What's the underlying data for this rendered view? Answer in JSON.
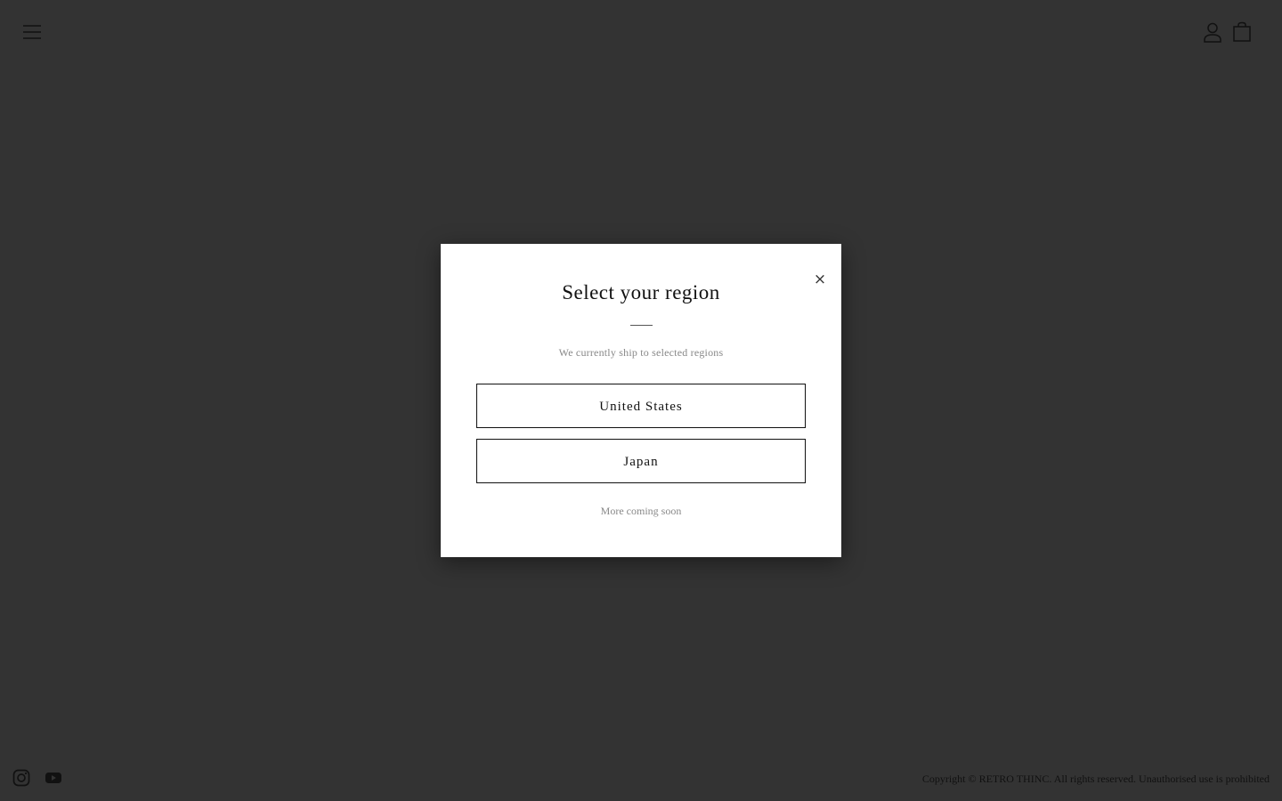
{
  "header": {
    "menu_icon": "hamburger-menu-icon",
    "account_icon": "account-icon",
    "cart_icon": "shopping-bag-icon"
  },
  "modal": {
    "title": "Select your region",
    "subtitle": "We currently ship to selected regions",
    "close_label": "×",
    "regions": [
      {
        "label": "United States"
      },
      {
        "label": "Japan"
      }
    ],
    "note": "More coming soon"
  },
  "footer": {
    "social_icons": [
      "instagram-icon",
      "youtube-icon"
    ],
    "copyright": "Copyright © RETRO THINC. All rights reserved. Unauthorised use is prohibited"
  },
  "colors": {
    "overlay": "#333333",
    "modal_bg": "#ffffff",
    "text": "#111111",
    "muted": "#888888"
  }
}
